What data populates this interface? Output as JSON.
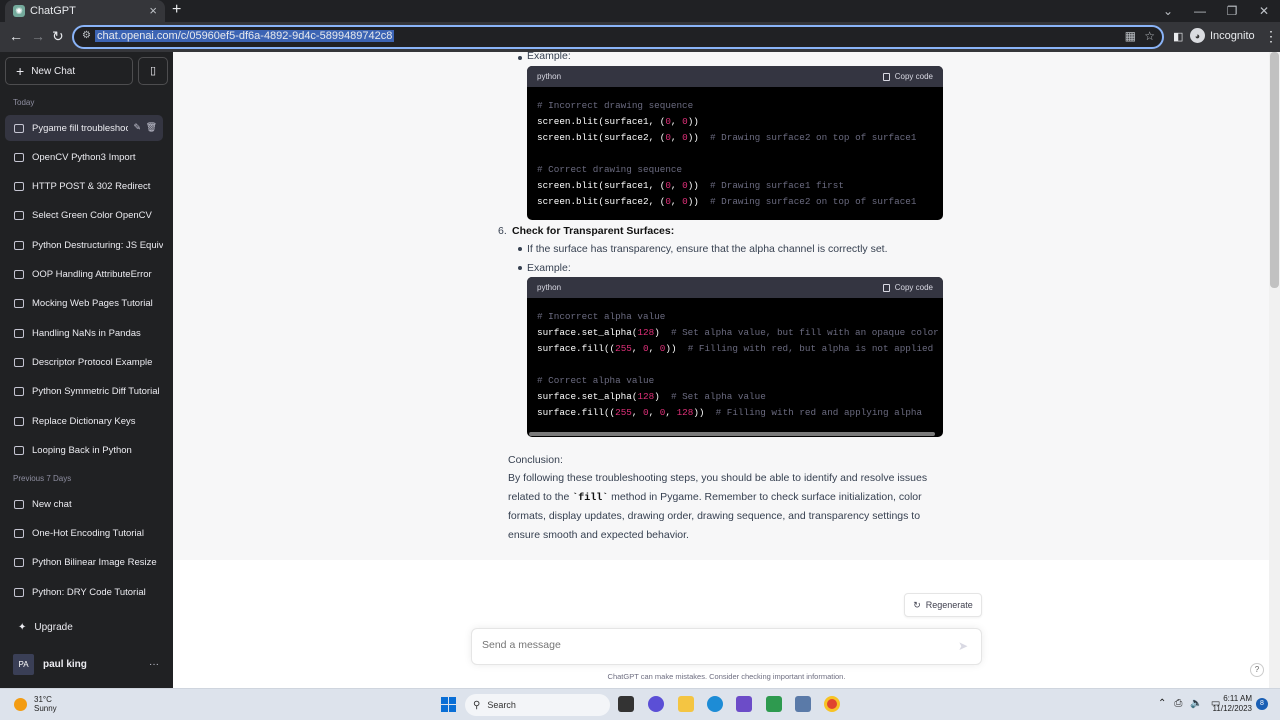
{
  "browser": {
    "tab_title": "ChatGPT",
    "tab_favicon": "chatgpt-logo",
    "url": "chat.openai.com/c/05960ef5-df6a-4892-9d4c-5899489742c8",
    "profile_label": "Incognito"
  },
  "sidebar": {
    "new_chat": "New Chat",
    "section_today": "Today",
    "today_items": [
      "Pygame fill troubleshoot",
      "OpenCV Python3 Import",
      "HTTP POST & 302 Redirect",
      "Select Green Color OpenCV",
      "Python Destructuring: JS Equivalent",
      "OOP Handling AttributeError",
      "Mocking Web Pages Tutorial",
      "Handling NaNs in Pandas",
      "Descriptor Protocol Example",
      "Python Symmetric Diff Tutorial",
      "Replace Dictionary Keys",
      "Looping Back in Python"
    ],
    "section_prev7": "Previous 7 Days",
    "prev7_items": [
      "New chat",
      "One-Hot Encoding Tutorial",
      "Python Bilinear Image Resize",
      "Python: DRY Code Tutorial"
    ],
    "upgrade": "Upgrade",
    "user_initials": "PA",
    "user_name": "paul king",
    "more": "···"
  },
  "chat": {
    "example1_label": "Example:",
    "step6_number": "6.",
    "step6_title": "Check for Transparent Surfaces:",
    "step6_bullet": "If the surface has transparency, ensure that the alpha channel is correctly set.",
    "example2_label": "Example:",
    "code_lang": "python",
    "copy_code": "Copy code",
    "conclusion_title": "Conclusion:",
    "conclusion_line1": "By following these troubleshooting steps, you should be able to identify and resolve issues",
    "conclusion_line2_pre": "related to the",
    "conclusion_code": "`fill`",
    "conclusion_line2_post": "method in Pygame. Remember to check surface initialization, color",
    "conclusion_line3": "formats, display updates, drawing order, drawing sequence, and transparency settings to",
    "conclusion_line4": "ensure smooth and expected behavior.",
    "regenerate": "Regenerate",
    "message_placeholder": "Send a message",
    "disclaimer": "ChatGPT can make mistakes. Consider checking important information.",
    "help": "?"
  },
  "taskbar": {
    "temperature": "31°C",
    "weather": "Sunny",
    "search": "Search",
    "time": "6:11 AM",
    "date": "11/12/2023",
    "notification_count": "8"
  }
}
